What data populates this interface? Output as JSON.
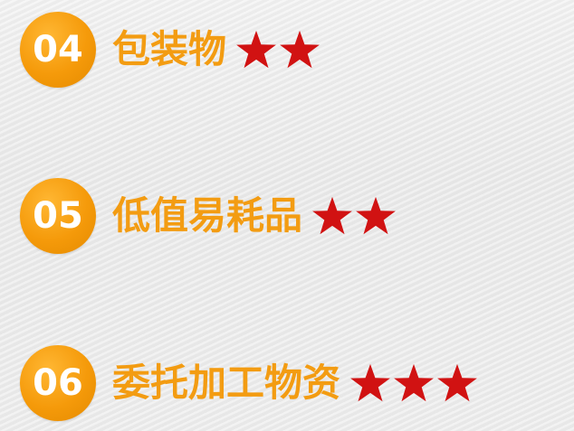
{
  "items": [
    {
      "number": "04",
      "label": "包装物",
      "stars": 2,
      "star_icon": "star-icon"
    },
    {
      "number": "05",
      "label": "低值易耗品",
      "stars": 2,
      "star_icon": "star-icon"
    },
    {
      "number": "06",
      "label": "委托加工物资",
      "stars": 3,
      "star_icon": "star-icon"
    }
  ],
  "colors": {
    "badge": "#f59a0a",
    "label": "#f39c12",
    "star": "#d11212",
    "badge_text": "#ffffff"
  }
}
